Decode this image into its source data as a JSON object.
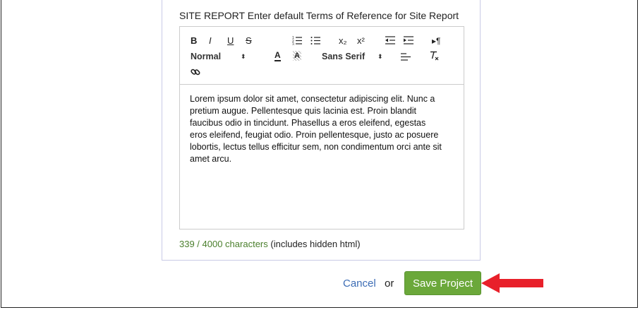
{
  "form": {
    "field_label": "SITE REPORT Enter default Terms of Reference for Site Report"
  },
  "toolbar": {
    "bold": "B",
    "italic": "I",
    "underline": "U",
    "strike": "S",
    "subscript": "x₂",
    "superscript": "x²",
    "direction": "▸¶",
    "header_picker": "Normal",
    "font_picker": "Sans Serif",
    "text_color": "A",
    "background_color": "A",
    "icons": [
      "bold-icon",
      "italic-icon",
      "underline-icon",
      "strike-icon",
      "ordered-list-icon",
      "bullet-list-icon",
      "subscript-icon",
      "superscript-icon",
      "outdent-icon",
      "indent-icon",
      "direction-icon",
      "text-color-icon",
      "background-color-icon",
      "align-icon",
      "clear-format-icon",
      "link-icon"
    ]
  },
  "editor": {
    "content": "Lorem ipsum dolor sit amet, consectetur adipiscing elit. Nunc a pretium augue. Pellentesque quis lacinia est. Proin blandit faucibus odio in tincidunt. Phasellus a eros eleifend, egestas eros eleifend, feugiat odio. Proin pellentesque, justo ac posuere lobortis, lectus tellus efficitur sem, non condimentum orci ante sit amet arcu."
  },
  "counter": {
    "count": "339 / 4000 characters",
    "note": "(includes hidden html)"
  },
  "actions": {
    "cancel_label": "Cancel",
    "or_label": "or",
    "save_label": "Save Project"
  },
  "colors": {
    "save_button": "#6ba83a",
    "counter_text": "#4a7f2c",
    "cancel_link": "#3d6db5",
    "arrow": "#e8202a"
  }
}
